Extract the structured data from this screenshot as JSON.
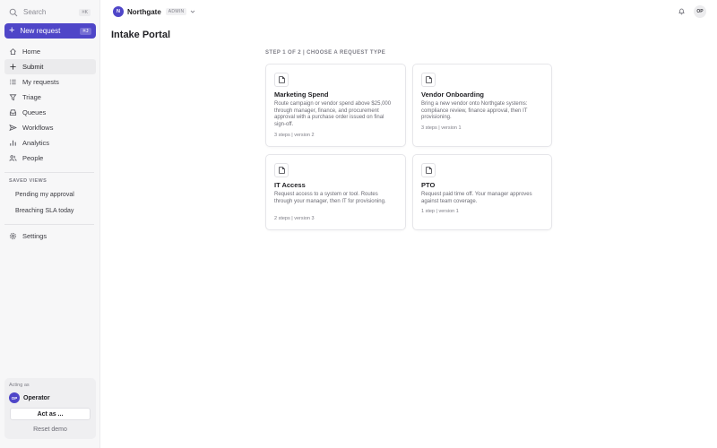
{
  "sidebar": {
    "search_label": "Search",
    "search_shortcut": "⌘K",
    "new_request_label": "New request",
    "new_request_shortcut": "⌘J",
    "nav": [
      {
        "label": "Home",
        "icon": "home-icon"
      },
      {
        "label": "Submit",
        "icon": "plus-icon",
        "active": true
      },
      {
        "label": "My requests",
        "icon": "list-icon"
      },
      {
        "label": "Triage",
        "icon": "funnel-icon"
      },
      {
        "label": "Queues",
        "icon": "inbox-icon"
      },
      {
        "label": "Workflows",
        "icon": "send-icon"
      },
      {
        "label": "Analytics",
        "icon": "bar-chart-icon"
      },
      {
        "label": "People",
        "icon": "users-icon"
      }
    ],
    "saved_views_title": "SAVED VIEWS",
    "saved_views": [
      "Pending my approval",
      "Breaching SLA today"
    ],
    "settings_label": "Settings",
    "acting_as_label": "Acting as",
    "acting_user_initials": "OP",
    "acting_user_name": "Operator",
    "act_as_button": "Act as ...",
    "reset_demo": "Reset demo"
  },
  "topbar": {
    "org_initial": "N",
    "org_name": "Northgate",
    "role_badge": "ADMIN",
    "user_initials": "OP"
  },
  "main": {
    "title": "Intake Portal",
    "step_label": "STEP 1 OF 2 | CHOOSE A REQUEST TYPE",
    "cards": [
      {
        "title": "Marketing Spend",
        "description": "Route campaign or vendor spend above $25,000 through manager, finance, and procurement approval with a purchase order issued on final sign-off.",
        "meta": "3 steps | version 2"
      },
      {
        "title": "Vendor Onboarding",
        "description": "Bring a new vendor onto Northgate systems: compliance review, finance approval, then IT provisioning.",
        "meta": "3 steps | version 1"
      },
      {
        "title": "IT Access",
        "description": "Request access to a system or tool. Routes through your manager, then IT for provisioning.",
        "meta": "2 steps | version 3"
      },
      {
        "title": "PTO",
        "description": "Request paid time off. Your manager approves against team coverage.",
        "meta": "1 step | version 1"
      }
    ]
  },
  "colors": {
    "accent": "#4f46c8",
    "sidebar_bg": "#f7f7f8",
    "active_nav_bg": "#ebebed"
  }
}
